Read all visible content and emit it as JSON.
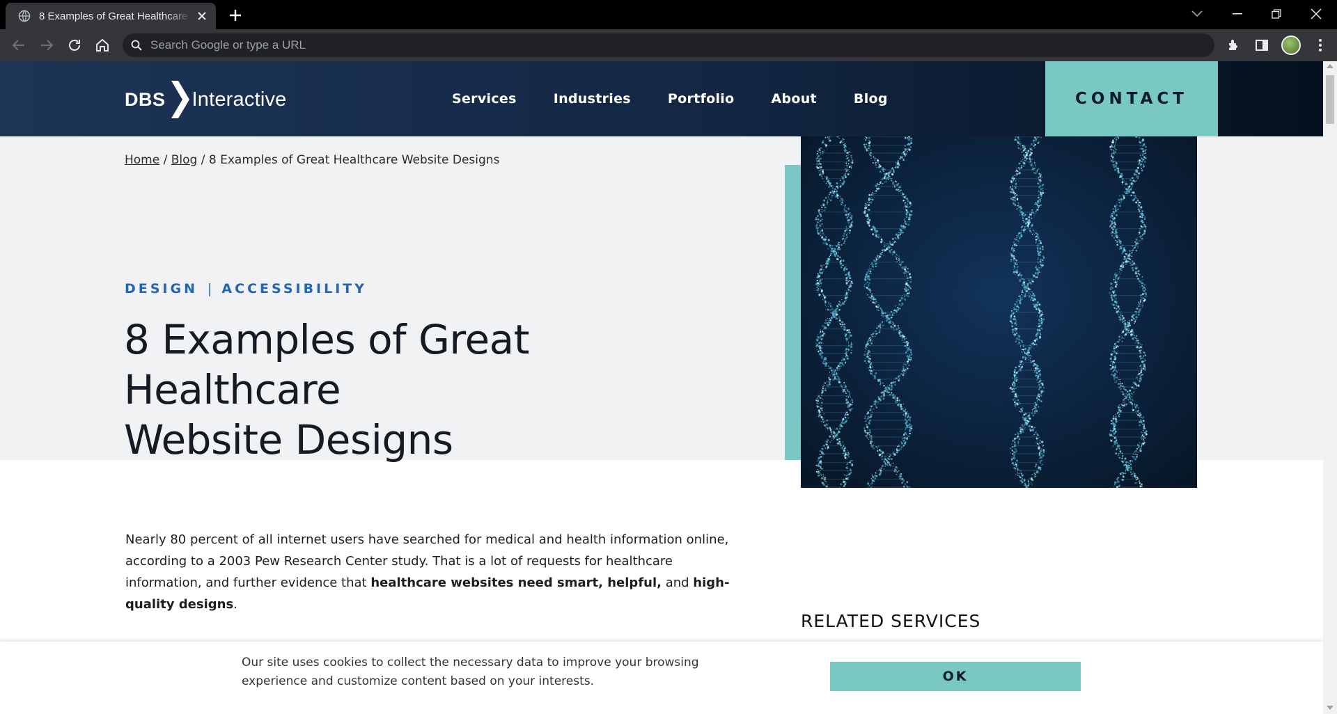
{
  "browser": {
    "tab_title": "8 Examples of Great Healthcare Website Designs",
    "omnibox_placeholder": "Search Google or type a URL"
  },
  "site": {
    "logo_bold": "DBS",
    "logo_text": "Interactive",
    "nav": [
      "Services",
      "Industries",
      "Portfolio",
      "About",
      "Blog"
    ],
    "contact_label": "CONTACT"
  },
  "breadcrumb": {
    "home": "Home",
    "sep": "/",
    "blog": "Blog",
    "current": "8 Examples of Great Healthcare Website Designs"
  },
  "categories": [
    "DESIGN",
    "ACCESSIBILITY"
  ],
  "category_sep": "|",
  "article": {
    "title_line1": "8 Examples of Great Healthcare",
    "title_line2": "Website Designs",
    "intro_part1": "Nearly 80 percent of all internet users have searched for medical and health information online, according to a 2003 Pew Research Center study. That is a lot of requests for healthcare information, and further evidence that ",
    "intro_bold1": "healthcare websites need smart, helpful,",
    "intro_part2": " and ",
    "intro_bold2": "high-quality designs",
    "intro_end": "."
  },
  "sidebar": {
    "related_heading": "RELATED SERVICES"
  },
  "cookie": {
    "message": "Our site uses cookies to collect the necessary data to improve your browsing experience and customize content based on your interests.",
    "ok_label": "OK"
  },
  "colors": {
    "teal": "#7ac8c3",
    "navy": "#132743",
    "category_blue": "#2266b3"
  }
}
